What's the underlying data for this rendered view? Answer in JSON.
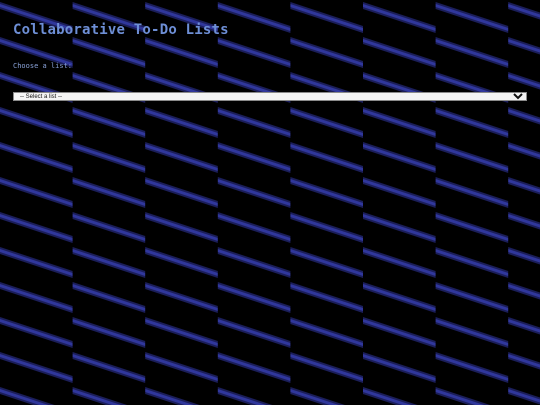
{
  "page": {
    "title": "Collaborative To-Do Lists",
    "choose_label": "Choose a list:",
    "list_select": {
      "selected": "-- Select a list --",
      "options": [
        "-- Select a list --"
      ]
    }
  },
  "colors": {
    "background": "#000000",
    "stripe": "#2e3396",
    "title": "#6e8fd6",
    "label": "#8aa2d8"
  }
}
